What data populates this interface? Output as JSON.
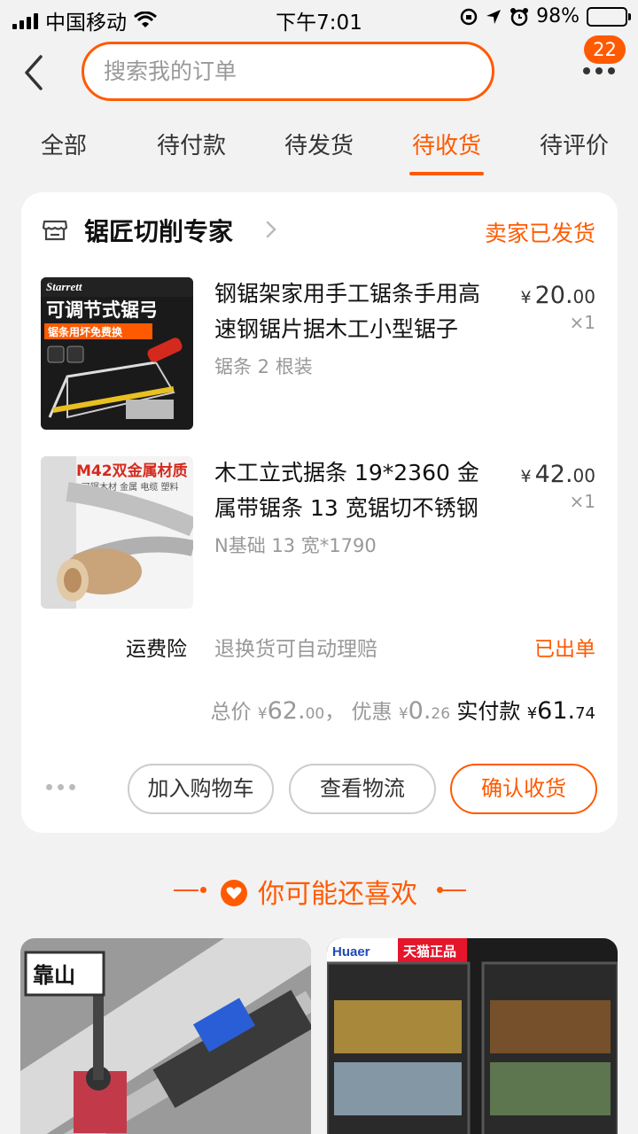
{
  "status_bar": {
    "carrier": "中国移动",
    "time": "下午7:01",
    "battery_percent": "98%"
  },
  "header": {
    "search_placeholder": "搜索我的订单",
    "message_count": "22"
  },
  "tabs": [
    {
      "label": "全部",
      "active": false
    },
    {
      "label": "待付款",
      "active": false
    },
    {
      "label": "待发货",
      "active": false
    },
    {
      "label": "待收货",
      "active": true
    },
    {
      "label": "待评价",
      "active": false
    }
  ],
  "order": {
    "shop_name": "锯匠切削专家",
    "status": "卖家已发货",
    "items": [
      {
        "title": "钢锯架家用手工锯条手用高速钢锯片据木工小型锯子",
        "sku": "锯条 2 根装",
        "price_yen": "¥",
        "price_int": "20.",
        "price_cents": "00",
        "qty": "×1",
        "thumb_text_brand": "Starrett",
        "thumb_text_main": "可调节式锯弓",
        "thumb_text_sub": "锯条用坏免费换"
      },
      {
        "title": "木工立式据条 19*2360 金属带锯条 13 宽锯切不锈钢",
        "sku": "N基础 13 宽*1790",
        "price_yen": "¥",
        "price_int": "42.",
        "price_cents": "00",
        "qty": "×1",
        "thumb_text_main": "M42双金属材质",
        "thumb_text_sub": "可锯木材 金属 电缆 塑料"
      }
    ],
    "insurance": {
      "label": "运费险",
      "desc": "退换货可自动理赔",
      "status": "已出单"
    },
    "totals": {
      "total_label": "总价",
      "total_yen": "¥",
      "total_int": "62.",
      "total_cents": "00",
      "sep": "，",
      "discount_label": "优惠",
      "discount_yen": "¥",
      "discount_int": "0.",
      "discount_cents": "26",
      "paid_label": "实付款",
      "paid_yen": "¥",
      "paid_int": "61.",
      "paid_cents": "74"
    },
    "actions": {
      "add_cart": "加入购物车",
      "logistics": "查看物流",
      "confirm": "确认收货"
    }
  },
  "recommend": {
    "title": "你可能还喜欢",
    "cards": [
      {
        "tag": "靠山"
      },
      {
        "brand": "Huaer",
        "badge": "天猫正品"
      }
    ]
  },
  "colors": {
    "accent": "#ff5a00",
    "background": "#f2f2f2"
  }
}
